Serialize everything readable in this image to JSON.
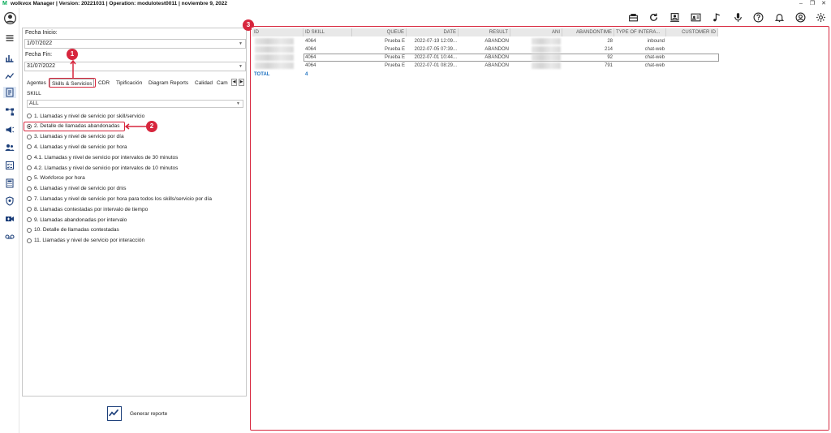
{
  "titlebar": {
    "logo": "M",
    "title": "wolkvox Manager  | Version: 20221031  | Operation: modulotest0011  | noviembre 9, 2022",
    "min": "–",
    "restore": "❐",
    "close": "✕"
  },
  "rail": {
    "items": [
      "avatar-icon",
      "menu-icon",
      "bar-chart-icon",
      "line-chart-icon",
      "report-icon",
      "flow-icon",
      "campaign-icon",
      "users-icon",
      "checklist-icon",
      "calculator-icon",
      "shield-icon",
      "video-icon",
      "voicemail-icon"
    ]
  },
  "toolbar": {
    "icons": [
      "tickets-icon",
      "refresh-icon",
      "contacts-icon",
      "id-card-icon",
      "music-icon",
      "microphone-icon",
      "help-icon",
      "bell-icon",
      "user-icon",
      "settings-icon"
    ]
  },
  "filters": {
    "fecha_inicio_label": "Fecha Inicio:",
    "fecha_inicio_value": "1/07/2022",
    "fecha_fin_label": "Fecha Fin:",
    "fecha_fin_value": "31/07/2022"
  },
  "tabs": [
    "Agentes",
    "Skills & Servicios",
    "CDR",
    "Tipificación",
    "Diagram Reports",
    "Calidad",
    "Cam"
  ],
  "skill": {
    "label": "SKILL",
    "value": "ALL"
  },
  "reports": [
    {
      "label": "1. Llamadas y nivel de servicio por skill/servicio",
      "selected": false
    },
    {
      "label": "2. Detalle de llamadas abandonadas",
      "selected": true
    },
    {
      "label": "3. Llamadas y nivel de servicio por día",
      "selected": false
    },
    {
      "label": "4. Llamadas y nivel de servicio por hora",
      "selected": false
    },
    {
      "label": "4.1. Llamadas y nivel de servicio por intervalos de 30 minutos",
      "selected": false
    },
    {
      "label": "4.2. Llamadas y nivel de servicio por intervalos de 10 minutos",
      "selected": false
    },
    {
      "label": "5. Workforce por hora",
      "selected": false
    },
    {
      "label": "6. Llamadas y nivel de servicio por dnis",
      "selected": false
    },
    {
      "label": "7. Llamadas y nivel de servicio por hora para todos los skills/servicio por día",
      "selected": false
    },
    {
      "label": "8. Llamadas contestadas por intervalo de tiempo",
      "selected": false
    },
    {
      "label": "9. Llamadas abandonadas por intervalo",
      "selected": false
    },
    {
      "label": "10. Detalle de llamadas contestadas",
      "selected": false
    },
    {
      "label": "11. Llamadas y nivel de servicio por interacción",
      "selected": false
    }
  ],
  "generate_label": "Generar reporte",
  "annotations": {
    "b1": "1",
    "b2": "2",
    "b3": "3"
  },
  "grid": {
    "columns": [
      "ID",
      "ID SKILL",
      "QUEUE",
      "DATE",
      "RESULT",
      "ANI",
      "ABANDONTIME",
      "TYPE OF INTERA...",
      "CUSTOMER ID"
    ],
    "rows": [
      {
        "id_skill": "4064",
        "queue": "Prueba E",
        "date": "2022-07-19 12:09...",
        "result": "ABANDON",
        "abandontime": "28",
        "type": "inbound"
      },
      {
        "id_skill": "4064",
        "queue": "Prueba E",
        "date": "2022-07-05 07:39...",
        "result": "ABANDON",
        "abandontime": "214",
        "type": "chat-web"
      },
      {
        "id_skill": "4064",
        "queue": "Prueba E",
        "date": "2022-07-01 10:44...",
        "result": "ABANDON",
        "abandontime": "92",
        "type": "chat-web"
      },
      {
        "id_skill": "4064",
        "queue": "Prueba E",
        "date": "2022-07-01 08:29...",
        "result": "ABANDON",
        "abandontime": "791",
        "type": "chat-web"
      }
    ],
    "total_label": "TOTAL",
    "total_value": "4"
  },
  "colors": {
    "accent_red": "#d7263d",
    "link_blue": "#1a6fbf"
  }
}
